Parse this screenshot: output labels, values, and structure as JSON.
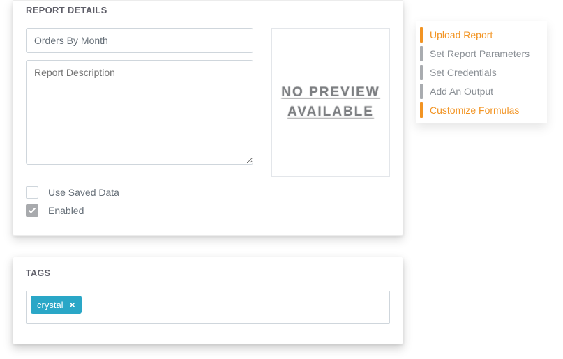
{
  "report_details": {
    "heading": "REPORT DETAILS",
    "name_value": "Orders By Month",
    "description_placeholder": "Report Description",
    "description_value": "",
    "preview_text": "NO PREVIEW AVAILABLE",
    "use_saved_data": {
      "label": "Use Saved Data",
      "checked": false
    },
    "enabled": {
      "label": "Enabled",
      "checked": true
    }
  },
  "tags": {
    "heading": "TAGS",
    "items": [
      {
        "label": "crystal"
      }
    ]
  },
  "steps": [
    {
      "label": "Upload Report",
      "active": true
    },
    {
      "label": "Set Report Parameters",
      "active": false
    },
    {
      "label": "Set Credentials",
      "active": false
    },
    {
      "label": "Add An Output",
      "active": false
    },
    {
      "label": "Customize Formulas",
      "active": true
    }
  ]
}
